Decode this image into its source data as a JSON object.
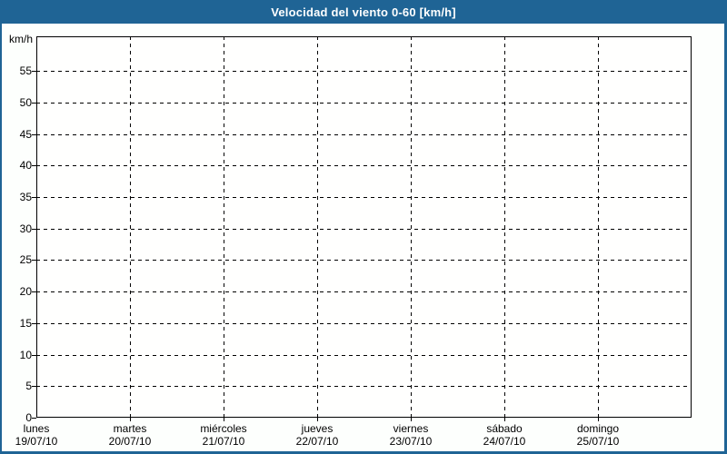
{
  "window": {
    "title": "Velocidad del viento 0-60 [km/h]"
  },
  "colors": {
    "titlebar_bg": "#1f6495",
    "titlebar_text": "#ffffff",
    "frame_border": "#1f6495",
    "page_bg": "#fdfffd",
    "plot_bg": "#fffffe",
    "grid": "#000000",
    "text": "#000000"
  },
  "chart_data": {
    "type": "line",
    "title": "Velocidad del viento 0-60 [km/h]",
    "xlabel": "",
    "ylabel": "km/h",
    "ylim": [
      0,
      60
    ],
    "yticks": [
      0,
      5,
      10,
      15,
      20,
      25,
      30,
      35,
      40,
      45,
      50,
      55
    ],
    "grid": "dashed",
    "legend_position": "none",
    "x_days": [
      {
        "day": "lunes",
        "date": "19/07/10"
      },
      {
        "day": "martes",
        "date": "20/07/10"
      },
      {
        "day": "miércoles",
        "date": "21/07/10"
      },
      {
        "day": "jueves",
        "date": "22/07/10"
      },
      {
        "day": "viernes",
        "date": "23/07/10"
      },
      {
        "day": "sábado",
        "date": "24/07/10"
      },
      {
        "day": "domingo",
        "date": "25/07/10"
      }
    ],
    "series": []
  }
}
